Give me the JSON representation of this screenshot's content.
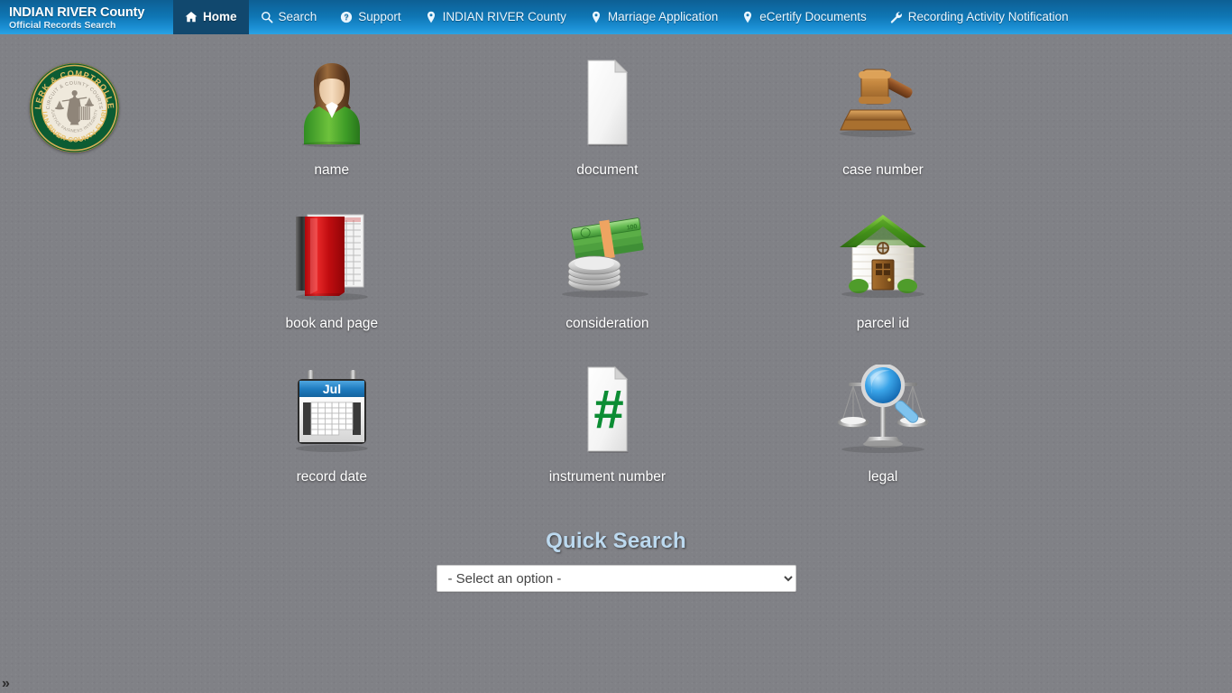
{
  "header": {
    "brand_title": "INDIAN RIVER County",
    "brand_subtitle": "Official Records Search",
    "nav": [
      {
        "label": "Home",
        "icon": "home-icon",
        "active": true
      },
      {
        "label": "Search",
        "icon": "search-icon",
        "active": false
      },
      {
        "label": "Support",
        "icon": "question-circle-icon",
        "active": false
      },
      {
        "label": "INDIAN RIVER County",
        "icon": "map-pin-icon",
        "active": false
      },
      {
        "label": "Marriage Application",
        "icon": "map-pin-icon",
        "active": false
      },
      {
        "label": "eCertify Documents",
        "icon": "map-pin-icon",
        "active": false
      },
      {
        "label": "Recording Activity Notification",
        "icon": "wrench-icon",
        "active": false
      }
    ]
  },
  "seal": {
    "name": "clerk-comptroller-seal",
    "outer_text": "CLERK & COMPTROLLER",
    "lower_text": "INDIAN RIVER COUNTY FLORIDA",
    "inner_text": "CIRCUIT & COUNTY COURTS"
  },
  "grid": {
    "rows": [
      [
        {
          "label": "name",
          "icon": "person-avatar-icon"
        },
        {
          "label": "document",
          "icon": "blank-document-icon"
        },
        {
          "label": "case number",
          "icon": "gavel-icon"
        }
      ],
      [
        {
          "label": "book and page",
          "icon": "red-book-icon"
        },
        {
          "label": "consideration",
          "icon": "money-coins-icon"
        },
        {
          "label": "parcel id",
          "icon": "house-icon"
        }
      ],
      [
        {
          "label": "record date",
          "icon": "calendar-icon"
        },
        {
          "label": "instrument number",
          "icon": "hash-document-icon"
        },
        {
          "label": "legal",
          "icon": "scales-magnifier-icon"
        }
      ]
    ]
  },
  "calendar": {
    "month_label": "Jul"
  },
  "quick_search": {
    "title": "Quick Search",
    "select_value": "- Select an option -",
    "options": [
      "- Select an option -"
    ]
  },
  "footer": {
    "toggle_glyph": "»"
  },
  "colors": {
    "nav_gradient_top": "#0d5f94",
    "nav_gradient_bottom": "#2aa3e4",
    "nav_active": "#11486e",
    "page_background": "#808186",
    "quick_search_title": "#bcd9ef",
    "seal_green": "#0c5c33",
    "seal_gold": "#b8912f"
  }
}
